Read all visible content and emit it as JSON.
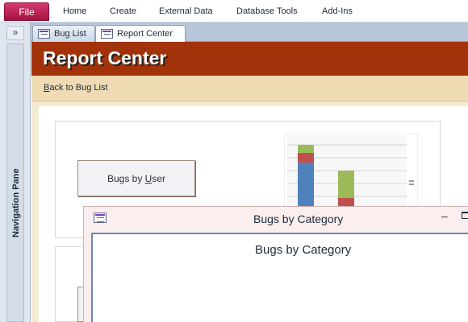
{
  "ribbon": {
    "file_label": "File",
    "tabs": [
      "Home",
      "Create",
      "External Data",
      "Database Tools",
      "Add-Ins"
    ]
  },
  "nav_pane": {
    "toggle_label": "»",
    "label": "Navigation Pane"
  },
  "doc_tabs": [
    {
      "label": "Bug List",
      "active": false
    },
    {
      "label": "Report Center",
      "active": true
    }
  ],
  "header": {
    "title": "Report Center",
    "color": "#a2320a"
  },
  "back_link": {
    "label_prefix": "B",
    "label_rest": "ack to Bug List"
  },
  "buttons": {
    "bugs_by_user_prefix": "Bugs by ",
    "bugs_by_user_underlined": "U",
    "bugs_by_user_rest": "ser"
  },
  "mini_chart": {
    "colors": {
      "blue": "#4f81bd",
      "red": "#c0504d",
      "green": "#9bbb59"
    }
  },
  "popup": {
    "title": "Bugs by Category",
    "minimize": "–",
    "body_title": "Bugs by Category"
  }
}
